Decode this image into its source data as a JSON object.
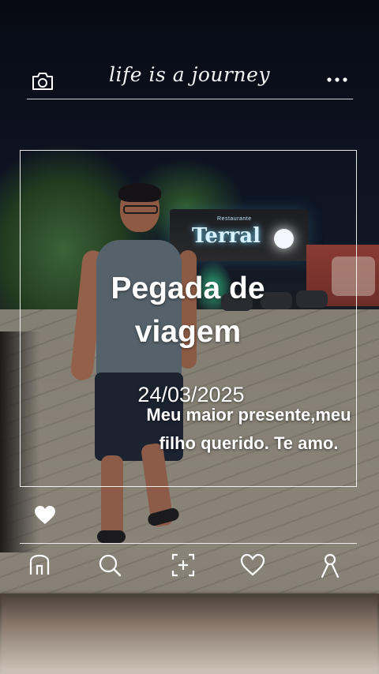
{
  "header": {
    "brand": "life is a journey",
    "left_icon": "camera-icon",
    "right_icon": "more-icon"
  },
  "background": {
    "sign_small": "Restaurante",
    "sign_big": "Terral"
  },
  "post": {
    "title": "Pegada de viagem",
    "date": "24/03/2025",
    "caption": "Meu maior presente,meu filho querido. Te amo."
  },
  "actions": {
    "like_icon": "heart-icon"
  },
  "nav": {
    "items": [
      {
        "icon": "home-icon"
      },
      {
        "icon": "search-icon"
      },
      {
        "icon": "add-icon"
      },
      {
        "icon": "heart-outline-icon"
      },
      {
        "icon": "profile-icon"
      }
    ]
  },
  "colors": {
    "text": "#ffffff",
    "line": "#ffffff"
  }
}
